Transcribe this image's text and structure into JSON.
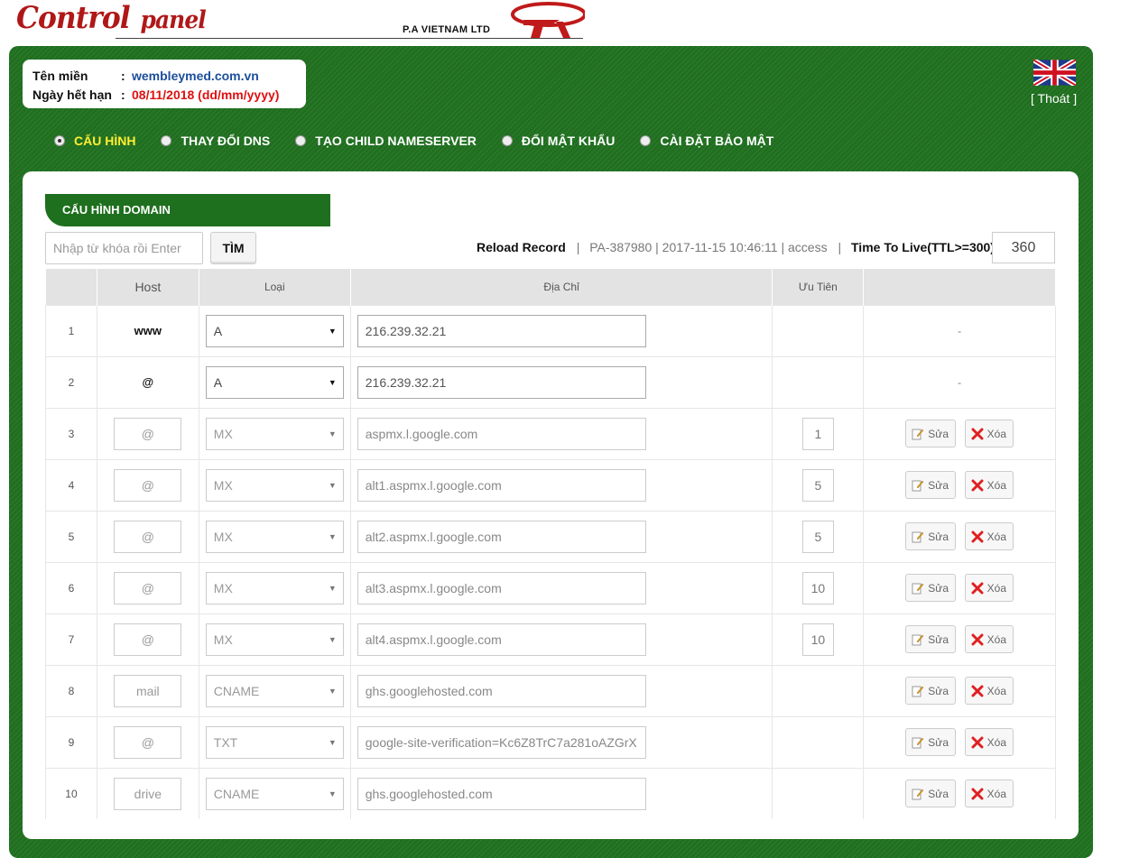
{
  "header": {
    "logo_text_main": "Control",
    "logo_text_sub": "panel",
    "company_name": "P.A VIETNAM LTD"
  },
  "info": {
    "domain_label": "Tên miền",
    "domain_value": "wembleymed.com.vn",
    "expiry_label": "Ngày hết hạn",
    "expiry_value": "08/11/2018 (dd/mm/yyyy)",
    "colon": ":"
  },
  "account": {
    "logout_label": "[ Thoát ]"
  },
  "tabs": [
    {
      "label": "CẤU HÌNH",
      "active": true
    },
    {
      "label": "THAY ĐỔI DNS",
      "active": false
    },
    {
      "label": "TẠO CHILD NAMESERVER",
      "active": false
    },
    {
      "label": "ĐỔI MẬT KHẨU",
      "active": false
    },
    {
      "label": "CÀI ĐẶT BẢO MẬT",
      "active": false
    }
  ],
  "section": {
    "title": "CẤU HÌNH DOMAIN"
  },
  "search": {
    "placeholder": "Nhập từ khóa rồi Enter",
    "button_label": "TÌM"
  },
  "status": {
    "reload_label": "Reload Record",
    "separator": "|",
    "record_info": "PA-387980 | 2017-11-15 10:46:11 | access",
    "ttl_label": "Time To Live(TTL>=300):",
    "ttl_value": "360"
  },
  "table": {
    "headers": {
      "host": "Host",
      "type": "Loại",
      "address": "Địa Chỉ",
      "priority": "Ưu Tiên"
    },
    "edit_label": "Sửa",
    "delete_label": "Xóa",
    "dash": "-",
    "rows": [
      {
        "num": "1",
        "host": "www",
        "type": "A",
        "address": "216.239.32.21",
        "priority": "",
        "editable": true
      },
      {
        "num": "2",
        "host": "@",
        "type": "A",
        "address": "216.239.32.21",
        "priority": "",
        "editable": true
      },
      {
        "num": "3",
        "host": "@",
        "type": "MX",
        "address": "aspmx.l.google.com",
        "priority": "1",
        "editable": false
      },
      {
        "num": "4",
        "host": "@",
        "type": "MX",
        "address": "alt1.aspmx.l.google.com",
        "priority": "5",
        "editable": false
      },
      {
        "num": "5",
        "host": "@",
        "type": "MX",
        "address": "alt2.aspmx.l.google.com",
        "priority": "5",
        "editable": false
      },
      {
        "num": "6",
        "host": "@",
        "type": "MX",
        "address": "alt3.aspmx.l.google.com",
        "priority": "10",
        "editable": false
      },
      {
        "num": "7",
        "host": "@",
        "type": "MX",
        "address": "alt4.aspmx.l.google.com",
        "priority": "10",
        "editable": false
      },
      {
        "num": "8",
        "host": "mail",
        "type": "CNAME",
        "address": "ghs.googlehosted.com",
        "priority": "",
        "editable": false
      },
      {
        "num": "9",
        "host": "@",
        "type": "TXT",
        "address": "google-site-verification=Kc6Z8TrC7a281oAZGrX",
        "priority": "",
        "editable": false
      },
      {
        "num": "10",
        "host": "drive",
        "type": "CNAME",
        "address": "ghs.googlehosted.com",
        "priority": "",
        "editable": false
      }
    ]
  },
  "colors": {
    "green": "#1f6f1f",
    "active_tab": "#ffee33",
    "logo_red": "#b01818",
    "domain_blue": "#1c4f9c",
    "expiry_red": "#dd1111"
  }
}
